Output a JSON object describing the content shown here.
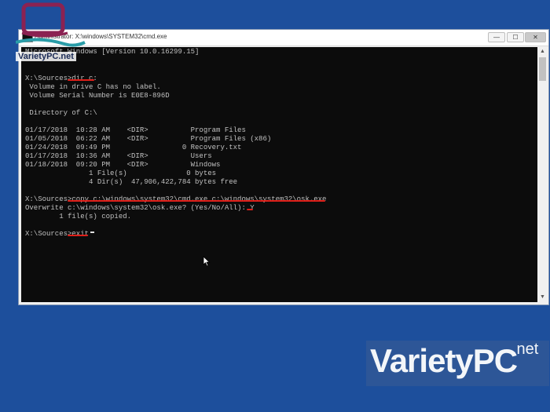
{
  "window": {
    "title": "Administrator: X:\\windows\\SYSTEM32\\cmd.exe",
    "minimize_label": "—",
    "maximize_label": "☐",
    "close_label": "✕"
  },
  "console": {
    "lines": [
      "Microsoft Windows [Version 10.0.16299.15]",
      "",
      "X:\\Sources>dir c:",
      " Volume in drive C has no label.",
      " Volume Serial Number is E0E8-896D",
      "",
      " Directory of C:\\",
      "",
      "01/17/2018  10:28 AM    <DIR>          Program Files",
      "01/05/2018  06:22 AM    <DIR>          Program Files (x86)",
      "01/24/2018  09:49 PM                 0 Recovery.txt",
      "01/17/2018  10:36 AM    <DIR>          Users",
      "01/18/2018  09:20 PM    <DIR>          Windows",
      "               1 File(s)              0 bytes",
      "               4 Dir(s)  47,906,422,784 bytes free",
      "",
      "X:\\Sources>copy c:\\windows\\system32\\cmd.exe c:\\windows\\system32\\osk.exe",
      "Overwrite c:\\windows\\system32\\osk.exe? (Yes/No/All): Y",
      "        1 file(s) copied.",
      "",
      "X:\\Sources>exit"
    ]
  },
  "logo_top_left": {
    "text": "VarietyPC.net"
  },
  "watermark": {
    "main": "VarietyPC",
    "suffix": ".net"
  },
  "colors": {
    "desktop": "#1d4f9c",
    "console_bg": "#0c0c0c",
    "console_text": "#c0c0c0",
    "annotation_red": "#e0201a"
  }
}
